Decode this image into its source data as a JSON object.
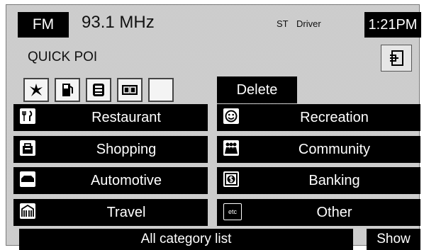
{
  "header": {
    "band": "FM",
    "frequency": "93.1 MHz",
    "stereo": "ST",
    "driver": "Driver",
    "time": "1:21PM"
  },
  "title": "QUICK POI",
  "icon_slots": [
    {
      "icon": "dining-icon"
    },
    {
      "icon": "gas-station-icon"
    },
    {
      "icon": "parking-icon"
    },
    {
      "icon": "atm-icon"
    },
    {
      "icon": "empty-slot"
    }
  ],
  "delete_label": "Delete",
  "categories": [
    {
      "label": "Restaurant",
      "icon": "fork-knife-icon"
    },
    {
      "label": "Recreation",
      "icon": "smiley-icon"
    },
    {
      "label": "Shopping",
      "icon": "shopping-bag-icon"
    },
    {
      "label": "Community",
      "icon": "people-icon"
    },
    {
      "label": "Automotive",
      "icon": "car-icon"
    },
    {
      "label": "Banking",
      "icon": "dollar-icon"
    },
    {
      "label": "Travel",
      "icon": "building-icon"
    },
    {
      "label": "Other",
      "icon": "etc-icon"
    }
  ],
  "etc_text": "etc",
  "bottom": {
    "list_label": "All category list",
    "show_label": "Show"
  },
  "colors": {
    "button_bg": "#000000",
    "screen_bg": "#d6d6d6",
    "text_light": "#ffffff"
  }
}
